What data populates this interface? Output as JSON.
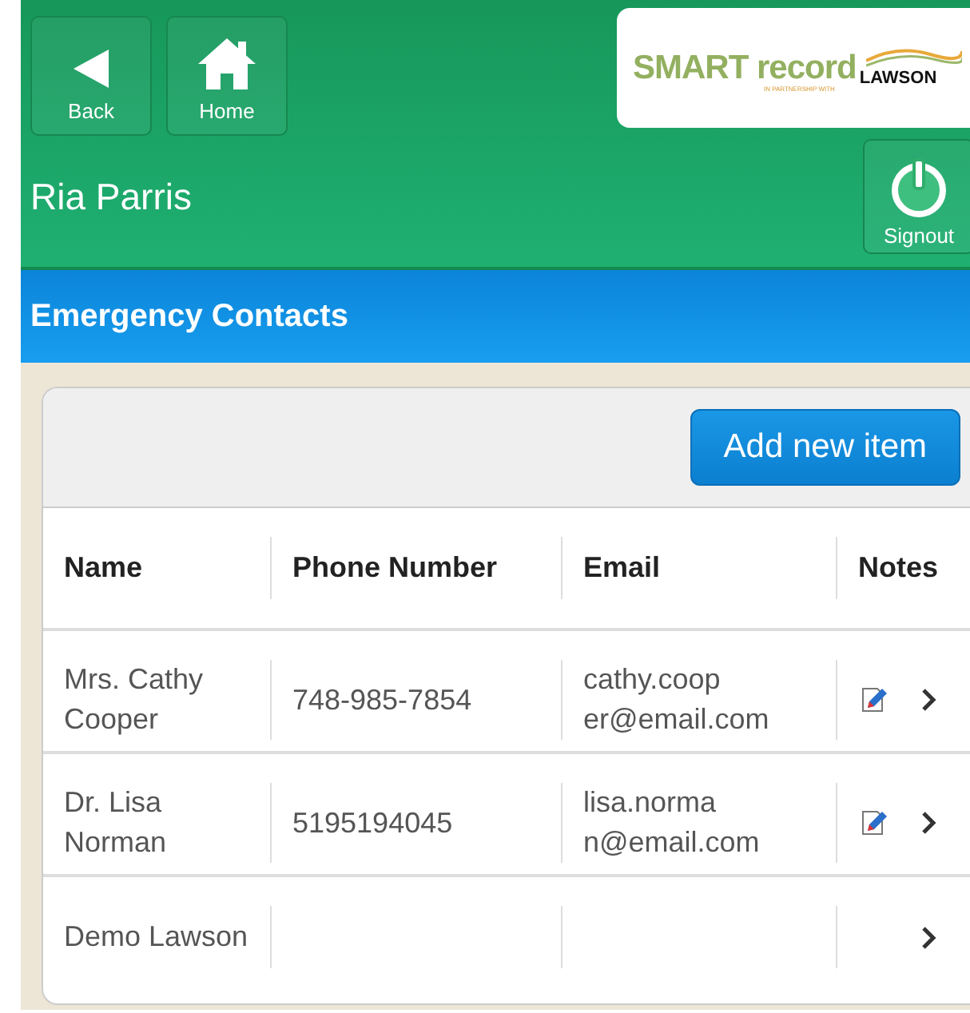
{
  "header": {
    "buttons": [
      {
        "kind": "back",
        "label": "Back"
      },
      {
        "kind": "home",
        "label": "Home"
      }
    ],
    "logo": {
      "title": "SMART record",
      "tagline": "IN PARTNERSHIP WITH",
      "partner": "LAWSON"
    },
    "user_name": "Ria Parris",
    "signout": {
      "label": "Signout"
    }
  },
  "section_title": "Emergency Contacts",
  "toolbar": {
    "add_button": "Add new item"
  },
  "table": {
    "columns": [
      "Name",
      "Phone Number",
      "Email",
      "Notes"
    ],
    "rows": [
      {
        "name": "Mrs. Cathy Cooper",
        "phone": "748-985-7854",
        "email": "cathy.coop er@email.com",
        "has_note": true
      },
      {
        "name": "Dr. Lisa Norman",
        "phone": "5195194045",
        "email": "lisa.norma n@email.com",
        "has_note": true
      },
      {
        "name": "Demo Lawson",
        "has_note": false
      }
    ]
  }
}
